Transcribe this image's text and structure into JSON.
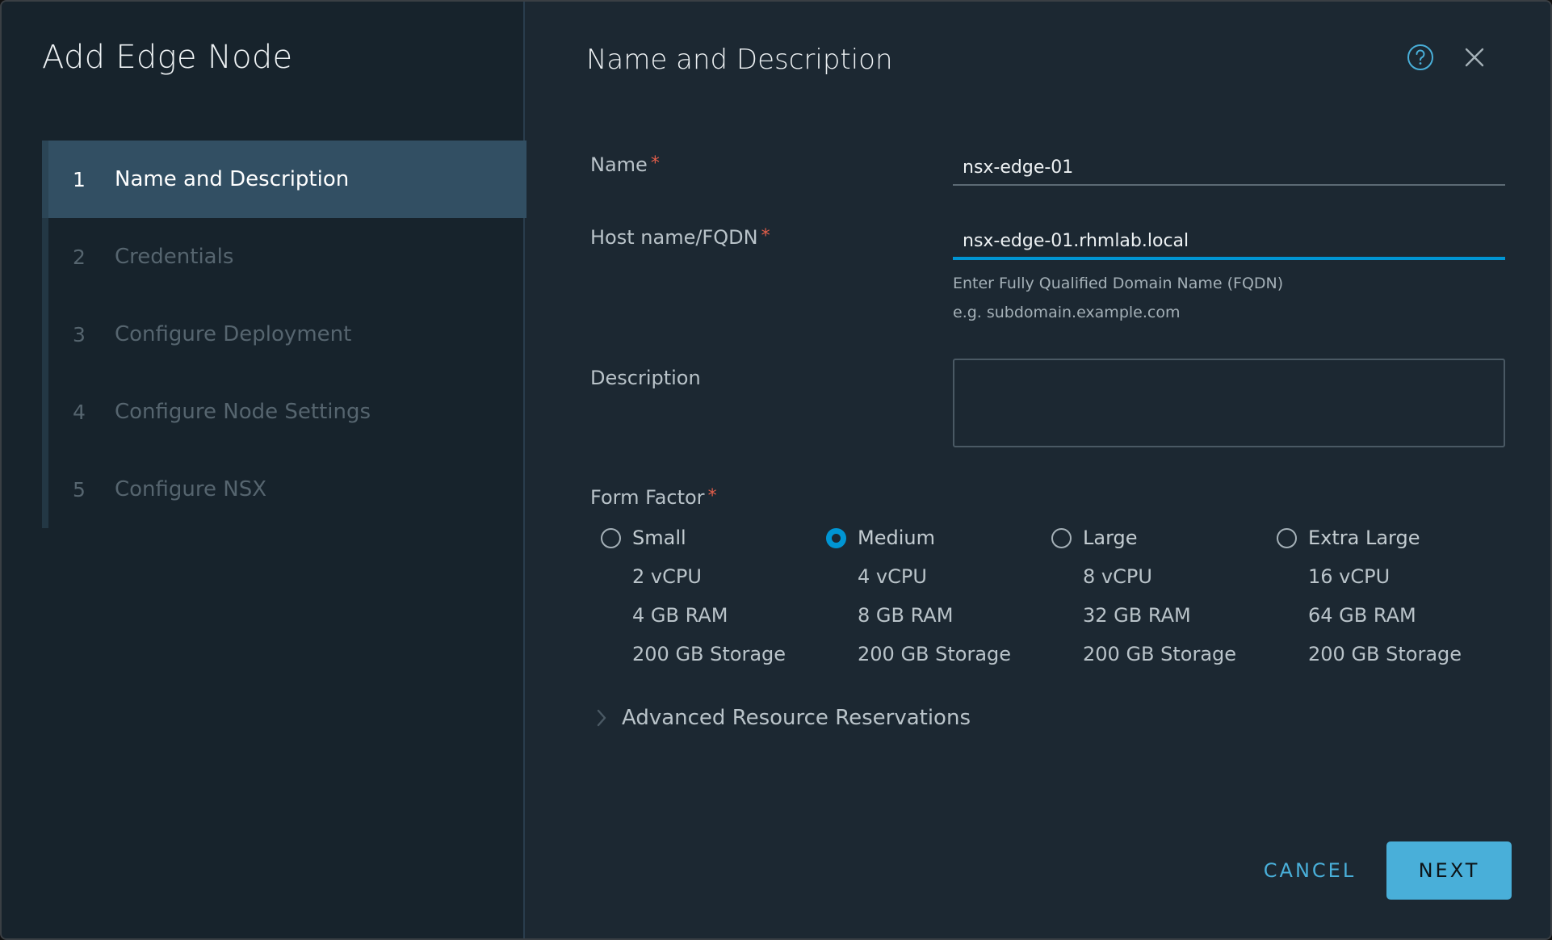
{
  "wizard": {
    "title": "Add Edge Node",
    "steps": [
      {
        "number": "1",
        "label": "Name and Description",
        "active": true
      },
      {
        "number": "2",
        "label": "Credentials",
        "active": false
      },
      {
        "number": "3",
        "label": "Configure Deployment",
        "active": false
      },
      {
        "number": "4",
        "label": "Configure Node Settings",
        "active": false
      },
      {
        "number": "5",
        "label": "Configure NSX",
        "active": false
      }
    ]
  },
  "header": {
    "title": "Name and Description",
    "help_icon": "help-circle-icon",
    "close_icon": "close-icon"
  },
  "form": {
    "required_mark": "*",
    "name": {
      "label": "Name",
      "value": "nsx-edge-01"
    },
    "hostname": {
      "label": "Host name/FQDN",
      "value": "nsx-edge-01.rhmlab.local",
      "help_line1": "Enter Fully Qualified Domain Name (FQDN)",
      "help_line2": "e.g. subdomain.example.com"
    },
    "description": {
      "label": "Description",
      "value": ""
    },
    "form_factor": {
      "label": "Form Factor",
      "selected": "Medium",
      "options": [
        {
          "name": "Small",
          "cpu": "2 vCPU",
          "ram": "4 GB RAM",
          "storage": "200 GB Storage"
        },
        {
          "name": "Medium",
          "cpu": "4 vCPU",
          "ram": "8 GB RAM",
          "storage": "200 GB Storage"
        },
        {
          "name": "Large",
          "cpu": "8 vCPU",
          "ram": "32 GB RAM",
          "storage": "200 GB Storage"
        },
        {
          "name": "Extra Large",
          "cpu": "16 vCPU",
          "ram": "64 GB RAM",
          "storage": "200 GB Storage"
        }
      ]
    },
    "advanced": {
      "label": "Advanced Resource Reservations",
      "icon": "chevron-right-icon"
    }
  },
  "footer": {
    "cancel_label": "CANCEL",
    "next_label": "NEXT"
  },
  "colors": {
    "accent": "#0095d3",
    "button_primary": "#49afd9",
    "required": "#e25e4a",
    "active_step_bg": "#324f63"
  }
}
